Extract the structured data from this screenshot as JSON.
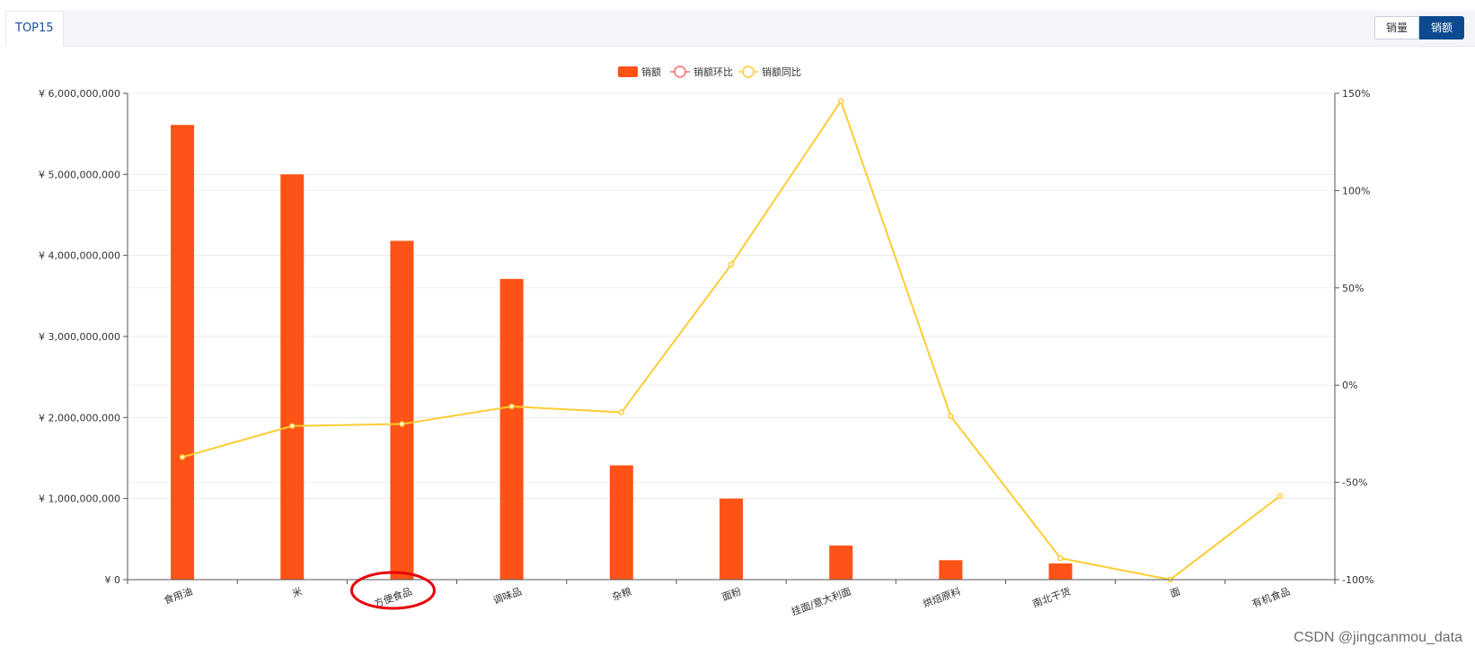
{
  "tabs": [
    {
      "label": "TOP15"
    }
  ],
  "toggle": {
    "qty_label": "销量",
    "amount_label": "销额",
    "active": "amount"
  },
  "watermark": "CSDN @jingcanmou_data",
  "chart_data": {
    "type": "bar+line",
    "categories": [
      "食用油",
      "米",
      "方便食品",
      "调味品",
      "杂粮",
      "面粉",
      "挂面/意大利面",
      "烘焙原料",
      "南北干货",
      "面",
      "有机食品"
    ],
    "series": [
      {
        "name": "销额",
        "type": "bar",
        "axis": "left",
        "color": "#ff5216",
        "values": [
          5610000000,
          5000000000,
          4180000000,
          3710000000,
          1410000000,
          1000000000,
          420000000,
          240000000,
          200000000,
          0,
          0
        ]
      },
      {
        "name": "销额环比",
        "type": "line",
        "axis": "right",
        "color": "#ff6b6b",
        "values": []
      },
      {
        "name": "销额同比",
        "type": "line",
        "axis": "right",
        "color": "#ffcc33",
        "values": [
          -37,
          -21,
          -20,
          -11,
          -14,
          62,
          146,
          -16,
          -89,
          -100,
          -57
        ]
      }
    ],
    "yLeft": {
      "min": 0,
      "max": 6000000000,
      "tick_labels": [
        "¥ 0",
        "¥ 1,000,000,000",
        "¥ 2,000,000,000",
        "¥ 3,000,000,000",
        "¥ 4,000,000,000",
        "¥ 5,000,000,000",
        "¥ 6,000,000,000"
      ]
    },
    "yRight": {
      "min": -100,
      "max": 150,
      "tick_labels": [
        "-100%",
        "-50%",
        "0%",
        "50%",
        "100%",
        "150%"
      ]
    },
    "legend": "top-center",
    "annotation": {
      "type": "ellipse",
      "target": "方便食品",
      "color": "#e8000b"
    }
  }
}
